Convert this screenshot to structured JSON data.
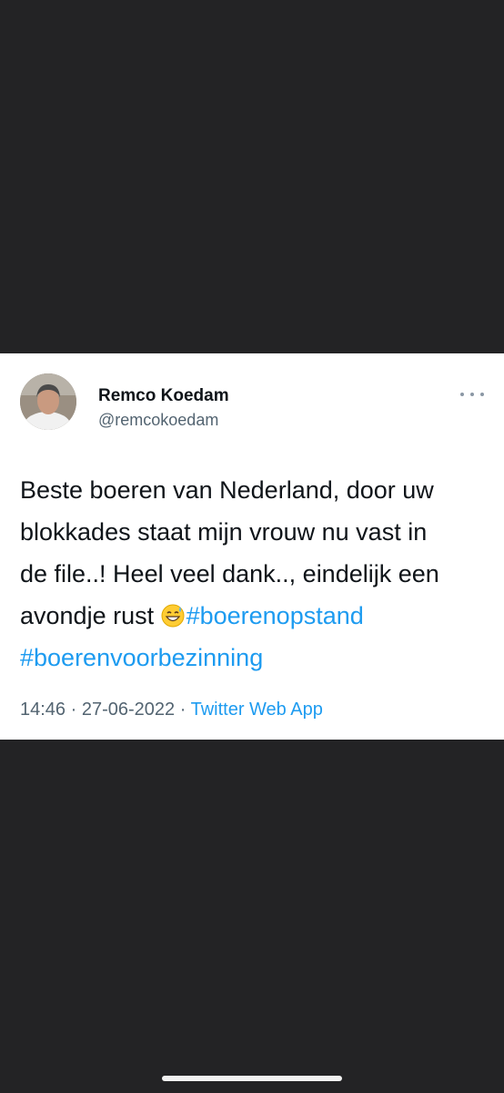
{
  "tweet": {
    "display_name": "Remco Koedam",
    "handle": "@remcokoedam",
    "more_icon": "more-horizontal-icon",
    "text_lines": [
      "Beste boeren van Nederland, door uw",
      "blokkades staat mijn vrouw nu vast in",
      "de file..! Heel veel dank.., eindelijk een",
      "avondje rust "
    ],
    "emoji": "grinning-face-with-sweat-emoji",
    "hashtags": [
      "#boerenopstand",
      "#boerenvoorbezinning"
    ],
    "time": "14:46",
    "date": "27-06-2022",
    "separator": " · ",
    "source": "Twitter Web App"
  },
  "colors": {
    "background": "#232325",
    "card": "#ffffff",
    "text": "#0f1419",
    "secondary": "#536471",
    "accent": "#1d9bf0"
  }
}
